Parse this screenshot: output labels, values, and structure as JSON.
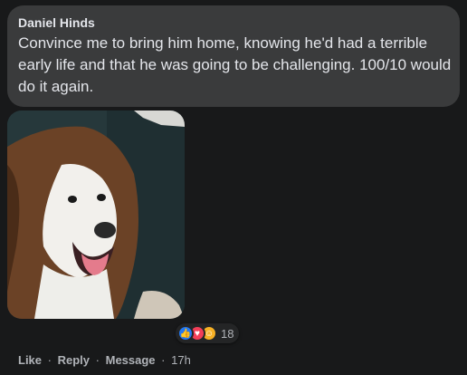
{
  "comment": {
    "author": "Daniel Hinds",
    "text": "Convince me to bring him home, knowing he'd had a terrible early life and that he was going to be challenging. 100/10 would do it again."
  },
  "reactions": {
    "icons": [
      "like-icon",
      "love-icon",
      "care-icon"
    ],
    "count": "18",
    "colors": {
      "like": "#2078f4",
      "love": "#f33e58",
      "care": "#f7b125"
    }
  },
  "actions": {
    "like": "Like",
    "reply": "Reply",
    "message": "Message",
    "separator": "·",
    "time": "17h"
  },
  "colors": {
    "background": "#18191a",
    "bubble": "#3a3b3c",
    "text": "#e4e6eb",
    "secondary_text": "#b0b3b8"
  }
}
